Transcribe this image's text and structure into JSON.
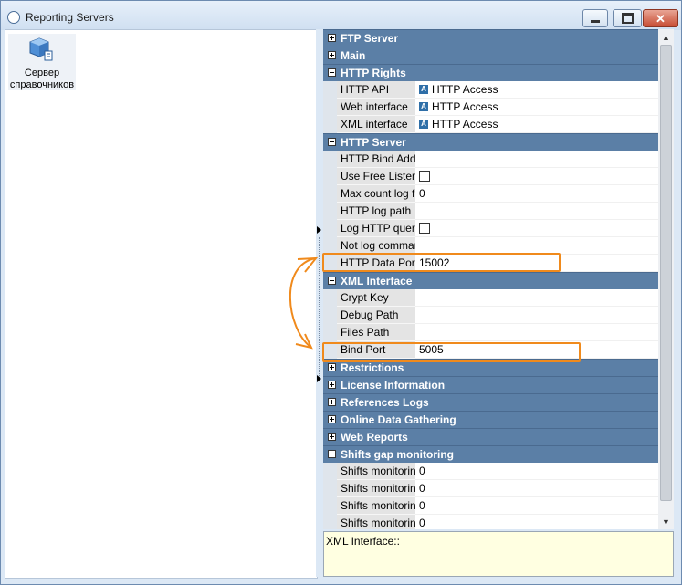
{
  "window": {
    "title": "Reporting Servers",
    "controls": {
      "minimize": "minimize",
      "maximize": "maximize",
      "close": "✕"
    }
  },
  "left": {
    "server_label": "Сервер справочников"
  },
  "grid": {
    "rows": [
      {
        "type": "category",
        "label": "FTP Server",
        "expanded": false
      },
      {
        "type": "category",
        "label": "Main",
        "expanded": false
      },
      {
        "type": "category",
        "label": "HTTP Rights",
        "expanded": true
      },
      {
        "type": "prop",
        "name": "HTTP API",
        "value": "HTTP Access",
        "icon": "access-icon"
      },
      {
        "type": "prop",
        "name": "Web interface",
        "value": "HTTP Access",
        "icon": "access-icon"
      },
      {
        "type": "prop",
        "name": "XML interface",
        "value": "HTTP Access",
        "icon": "access-icon"
      },
      {
        "type": "category",
        "label": "HTTP Server",
        "expanded": true
      },
      {
        "type": "prop",
        "name": "HTTP Bind Addre",
        "value": ""
      },
      {
        "type": "prop",
        "name": "Use Free Listen P",
        "value": "",
        "checkbox": true
      },
      {
        "type": "prop",
        "name": "Max count log file",
        "value": "0"
      },
      {
        "type": "prop",
        "name": "HTTP log path",
        "value": ""
      },
      {
        "type": "prop",
        "name": "Log HTTP query",
        "value": "",
        "checkbox": true
      },
      {
        "type": "prop",
        "name": "Not log comman",
        "value": ""
      },
      {
        "type": "prop",
        "name": "HTTP Data Port",
        "value": "15002"
      },
      {
        "type": "category",
        "label": "XML Interface",
        "expanded": true
      },
      {
        "type": "prop",
        "name": "Crypt Key",
        "value": ""
      },
      {
        "type": "prop",
        "name": "Debug Path",
        "value": ""
      },
      {
        "type": "prop",
        "name": "Files Path",
        "value": ""
      },
      {
        "type": "prop",
        "name": "Bind Port",
        "value": "5005"
      },
      {
        "type": "category",
        "label": "Restrictions",
        "expanded": false
      },
      {
        "type": "category",
        "label": "License Information",
        "expanded": false
      },
      {
        "type": "category",
        "label": "References Logs",
        "expanded": false
      },
      {
        "type": "category",
        "label": "Online Data Gathering",
        "expanded": false
      },
      {
        "type": "category",
        "label": "Web Reports",
        "expanded": false
      },
      {
        "type": "category",
        "label": "Shifts gap monitoring",
        "expanded": true
      },
      {
        "type": "prop",
        "name": "Shifts monitoring",
        "value": "0"
      },
      {
        "type": "prop",
        "name": "Shifts monitoring",
        "value": "0"
      },
      {
        "type": "prop",
        "name": "Shifts monitoring",
        "value": "0"
      },
      {
        "type": "prop",
        "name": "Shifts monitoring",
        "value": "0"
      }
    ]
  },
  "description": {
    "text": "XML Interface::"
  },
  "colors": {
    "category": "#5b7fa6",
    "highlight": "#f08a1c",
    "description_bg": "#ffffe1"
  }
}
